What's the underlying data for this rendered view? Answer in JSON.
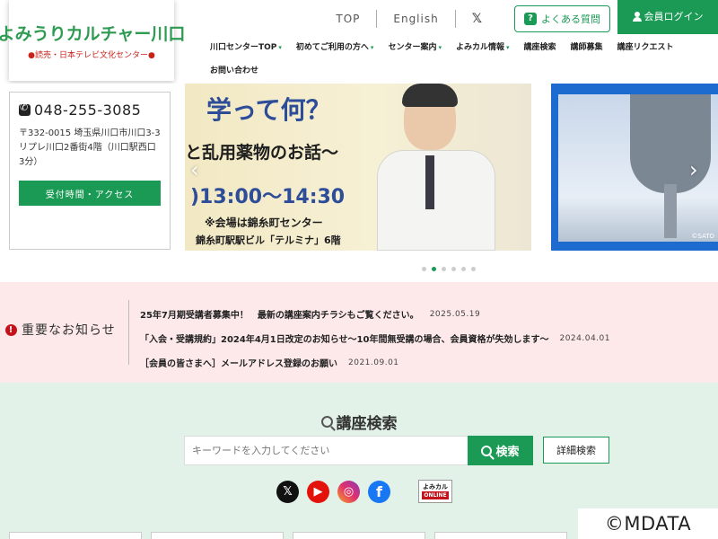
{
  "header": {
    "logo_main": "よみうりカルチャー川口",
    "logo_sub": "●読売・日本テレビ文化センター●",
    "utility": {
      "top": "TOP",
      "english": "English",
      "x_label": "𝕏"
    },
    "faq_label": "よくある質問",
    "faq_badge": "?",
    "login_label": "会員ログイン"
  },
  "nav": [
    {
      "label": "川口センターTOP",
      "caret": "▾"
    },
    {
      "label": "初めてご利用の方へ",
      "caret": "▾"
    },
    {
      "label": "センター案内",
      "caret": "▾"
    },
    {
      "label": "よみカル情報",
      "caret": "▾"
    },
    {
      "label": "講座検索",
      "caret": ""
    },
    {
      "label": "講師募集",
      "caret": ""
    },
    {
      "label": "講座リクエスト",
      "caret": ""
    },
    {
      "label": "お問い合わせ",
      "caret": ""
    }
  ],
  "contact": {
    "phone": "048-255-3085",
    "address": "〒332-0015 埼玉県川口市川口3-3 リプレ川口2番街4階（川口駅西口3分）",
    "access_button": "受付時間・アクセス"
  },
  "slider": {
    "slide1": {
      "line1": "学って何？",
      "line2": "と乱用薬物のお話〜",
      "line3": ")13:00〜14:30",
      "line4": "※会場は錦糸町センター",
      "line5": "錦糸町駅駅ビル「テルミナ」6階"
    },
    "slide2": {
      "credit": "©SATO"
    },
    "prev_arrow": "‹",
    "next_arrow": "›",
    "total_slides": 6,
    "active_index": 1
  },
  "notices": {
    "title": "重要なお知らせ",
    "icon_label": "!",
    "items": [
      {
        "text": "25年7月期受講者募集中！　最新の講座案内チラシもご覧ください。",
        "date": "2025.05.19"
      },
      {
        "text": "「入会・受講規約」2024年4月1日改定のお知らせ〜10年間無受講の場合、会員資格が失効します〜",
        "date": "2024.04.01"
      },
      {
        "text": "［会員の皆さまへ］メールアドレス登録のお願い",
        "date": "2021.09.01"
      }
    ]
  },
  "search": {
    "heading": "講座検索",
    "placeholder": "キーワードを入力してください",
    "button": "検索",
    "advanced": "詳細検索"
  },
  "social": {
    "x": "𝕏",
    "youtube": "▶",
    "instagram": "◎",
    "facebook": "f",
    "yomikaru_top": "よみカル",
    "yomikaru_bottom": "ONLINE"
  },
  "watermark": "©MDATA",
  "colors": {
    "brand_green": "#1a9a54",
    "alert_red": "#c5121a",
    "notice_bg": "#fde9ea",
    "search_bg": "#e2f2e8"
  }
}
